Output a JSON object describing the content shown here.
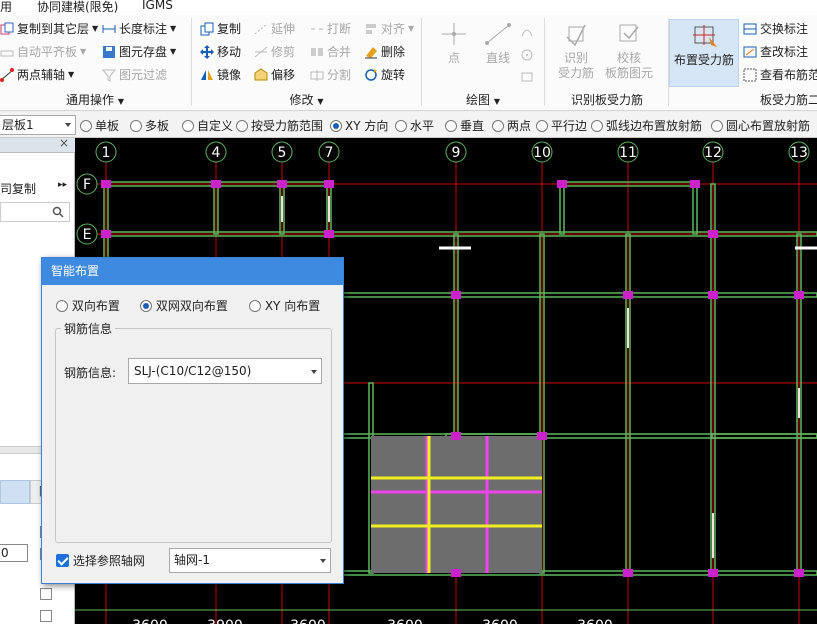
{
  "menu": {
    "items": [
      "用",
      "协同建模(限免)",
      "IGMS"
    ]
  },
  "ribbon": {
    "groups": {
      "general": "通用操作",
      "modify": "修改",
      "draw": "绘图",
      "identify": "识别板受力筋",
      "slab_rebar": "板受力筋二"
    },
    "general": {
      "copy_to_layer": "复制到其它层",
      "auto_flush": "自动平齐板",
      "two_point_axis": "两点辅轴",
      "length_mark": "长度标注",
      "element_save": "图元存盘",
      "element_filter": "图元过滤"
    },
    "modify": {
      "copy": "复制",
      "extend": "延伸",
      "break": "打断",
      "align": "对齐",
      "move": "移动",
      "trim": "修剪",
      "merge": "合并",
      "delete": "删除",
      "mirror": "镜像",
      "offset": "偏移",
      "split": "分割",
      "rotate": "旋转"
    },
    "draw": {
      "point": "点",
      "line": "直线"
    },
    "identify": {
      "recognize_l1": "识别",
      "recognize_l2": "受力筋",
      "check_l1": "校核",
      "check_l2": "板筋图元"
    },
    "slab": {
      "place_rebar": "布置受力筋",
      "swap_mark": "交换标注",
      "view_mark": "查改标注",
      "view_range": "查看布筋范"
    }
  },
  "optbar": {
    "layer_combo": "层板1",
    "options": [
      "单板",
      "多板",
      "自定义",
      "按受力筋范围",
      "XY 方向",
      "水平",
      "垂直",
      "两点",
      "平行边",
      "弧线边布置放射筋",
      "圆心布置放射筋"
    ],
    "selected": 4
  },
  "left_panel": {
    "copy_label": "司复制",
    "col_label": "附",
    "cell_value": "0"
  },
  "canvas": {
    "axis_labels_top": [
      "1",
      "4",
      "5",
      "7",
      "9",
      "10",
      "11",
      "12",
      "13"
    ],
    "axis_labels_left": [
      "F",
      "E"
    ],
    "dims_bottom": [
      "3600",
      "3900",
      "3600",
      "3600",
      "3600",
      "3600"
    ],
    "colors": {
      "beam": "#5cb85c",
      "rebar": "#cc22cc",
      "axis": "#cc0000",
      "slab": "#6d6d6d",
      "bubble": "#ffffff"
    }
  },
  "dialog": {
    "title": "智能布置",
    "layout_options": [
      "双向布置",
      "双网双向布置",
      "XY 向布置"
    ],
    "layout_selected": 1,
    "group_label": "钢筋信息",
    "rebar_label": "钢筋信息:",
    "rebar_value": "SLJ-(C10/C12@150)",
    "grid_check_label": "选择参照轴网",
    "grid_value": "轴网-1"
  }
}
